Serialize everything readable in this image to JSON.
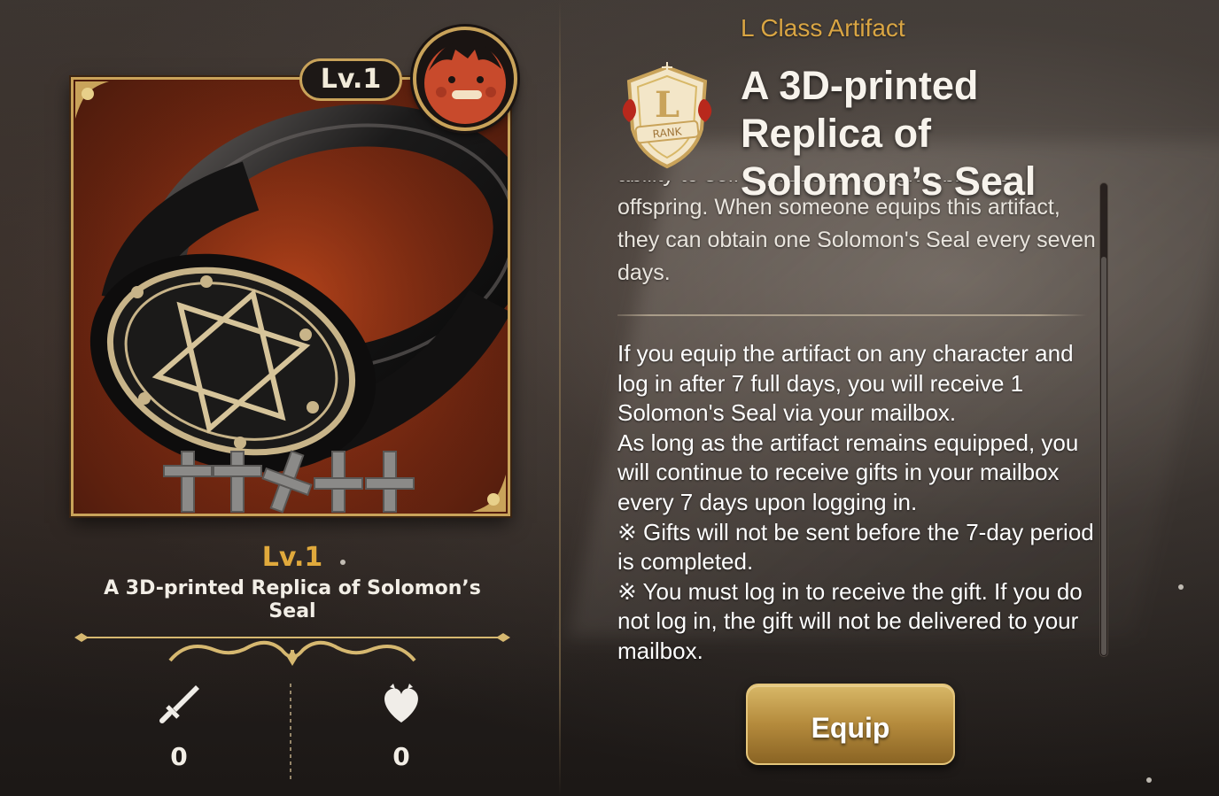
{
  "card": {
    "level_badge": "Lv.1",
    "level_label": "Lv.1",
    "name": "A 3D-printed Replica of Solomon’s Seal",
    "stats": {
      "attack_value": "0",
      "hp_value": "0"
    }
  },
  "artifact": {
    "class_label": "L Class Artifact",
    "rank_text": "RANK",
    "rank_letter": "L",
    "title": "A 3D-printed Replica of Solomon’s Seal",
    "description_top": "ability to self-reproduce and give birth to offspring. When someone equips this artifact, they can obtain one Solomon's Seal every seven days.",
    "description_body": "If you equip the artifact on any character and log in after 7 full days, you will receive 1 Solomon's Seal via your mailbox.\nAs long as the artifact remains equipped, you will continue to receive gifts in your mailbox every 7 days upon logging in.\n※ Gifts will not be sent before the 7-day period is completed.\n※ You must log in to receive the gift. If you do not log in, the gift will not be delivered to your mailbox."
  },
  "actions": {
    "equip_label": "Equip"
  },
  "icons": {
    "attack": "sword-icon",
    "hp": "heart-icon",
    "rank": "rank-shield-icon",
    "avatar": "character-avatar"
  },
  "colors": {
    "gold": "#c9a35a",
    "level_orange": "#e0a93c",
    "class_label": "#d9a543",
    "card_red": "#a33a18"
  }
}
